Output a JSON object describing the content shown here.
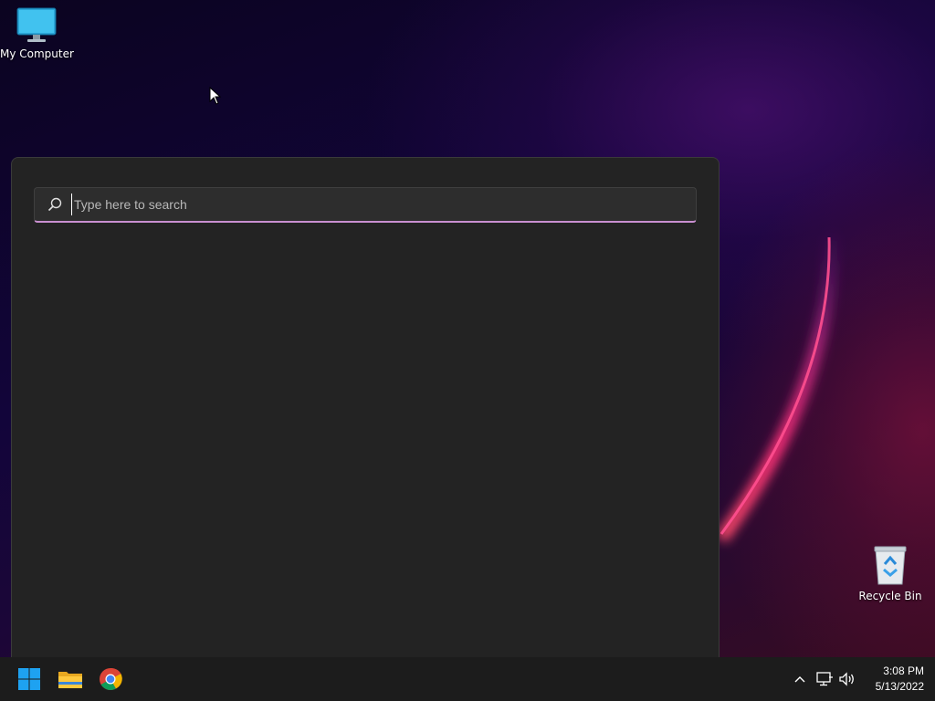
{
  "desktop": {
    "icons": [
      {
        "label": "My Computer",
        "icon": "monitor-icon"
      },
      {
        "label": "Recycle Bin",
        "icon": "recycle-bin-icon"
      }
    ]
  },
  "search": {
    "placeholder": "Type here to search",
    "value": "",
    "accent_color": "#c98fd0"
  },
  "taskbar": {
    "pinned": [
      {
        "name": "Start",
        "icon": "windows-logo-icon"
      },
      {
        "name": "File Explorer",
        "icon": "folder-icon"
      },
      {
        "name": "Google Chrome",
        "icon": "chrome-icon"
      }
    ],
    "tray": {
      "icons": [
        "chevron-up-icon",
        "network-icon",
        "volume-icon"
      ],
      "time": "3:08 PM",
      "date": "5/13/2022"
    }
  },
  "colors": {
    "panel_bg": "#232323",
    "taskbar_bg": "#1c1c1c",
    "windows_blue": "#1ea2f1"
  }
}
